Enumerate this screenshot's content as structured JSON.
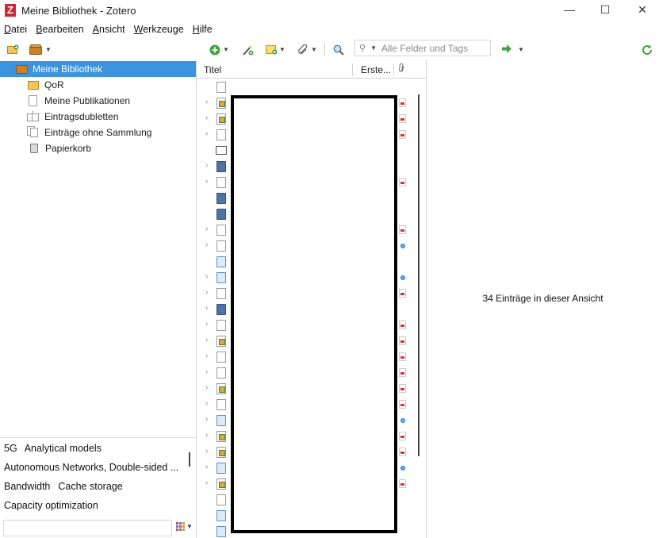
{
  "window": {
    "title": "Meine Bibliothek - Zotero",
    "logo_letter": "Z",
    "controls": {
      "minimize": "—",
      "maximize": "☐",
      "close": "✕"
    }
  },
  "menu": [
    {
      "label": "Datei"
    },
    {
      "label": "Bearbeiten"
    },
    {
      "label": "Ansicht"
    },
    {
      "label": "Werkzeuge"
    },
    {
      "label": "Hilfe"
    }
  ],
  "toolbar": {
    "search_placeholder": "Alle Felder und Tags",
    "colors": {
      "new_item": "#3fa63f",
      "locate": "#3fa63f",
      "sync": "#3fa63f"
    }
  },
  "collections": [
    {
      "label": "Meine Bibliothek",
      "icon": "library-icon",
      "selected": true
    },
    {
      "label": "QoR",
      "icon": "folder-icon"
    },
    {
      "label": "Meine Publikationen",
      "icon": "document-icon"
    },
    {
      "label": "Eintragsdubletten",
      "icon": "duplicates-icon"
    },
    {
      "label": "Einträge ohne Sammlung",
      "icon": "unfiled-icon"
    },
    {
      "label": "Papierkorb",
      "icon": "trash-icon"
    }
  ],
  "tags": {
    "rows": [
      [
        "5G",
        "Analytical models"
      ],
      [
        "Autonomous Networks, Double-sided ..."
      ],
      [
        "Bandwidth",
        "Cache storage"
      ],
      [
        "Capacity optimization"
      ]
    ],
    "filter_value": ""
  },
  "items_table": {
    "columns": {
      "title": "Titel",
      "creator": "Erste..."
    },
    "rows": [
      {
        "twisty": false,
        "type": "document",
        "attachment": ""
      },
      {
        "twisty": true,
        "type": "journal-article",
        "attachment": "pdf"
      },
      {
        "twisty": true,
        "type": "journal-article",
        "attachment": "pdf"
      },
      {
        "twisty": true,
        "type": "document",
        "attachment": "pdf"
      },
      {
        "twisty": false,
        "type": "presentation",
        "attachment": ""
      },
      {
        "twisty": true,
        "type": "book",
        "attachment": ""
      },
      {
        "twisty": true,
        "type": "document",
        "attachment": "pdf"
      },
      {
        "twisty": false,
        "type": "book",
        "attachment": ""
      },
      {
        "twisty": false,
        "type": "book",
        "attachment": ""
      },
      {
        "twisty": true,
        "type": "document",
        "attachment": "pdf"
      },
      {
        "twisty": true,
        "type": "document",
        "attachment": "link"
      },
      {
        "twisty": false,
        "type": "preprint",
        "attachment": ""
      },
      {
        "twisty": true,
        "type": "preprint",
        "attachment": "link"
      },
      {
        "twisty": true,
        "type": "document",
        "attachment": "pdf"
      },
      {
        "twisty": true,
        "type": "book",
        "attachment": ""
      },
      {
        "twisty": true,
        "type": "document",
        "attachment": "pdf"
      },
      {
        "twisty": true,
        "type": "journal-article",
        "attachment": "pdf"
      },
      {
        "twisty": true,
        "type": "document",
        "attachment": "pdf"
      },
      {
        "twisty": true,
        "type": "document",
        "attachment": "pdf"
      },
      {
        "twisty": true,
        "type": "journal-article",
        "attachment": "pdf"
      },
      {
        "twisty": true,
        "type": "document",
        "attachment": "pdf"
      },
      {
        "twisty": true,
        "type": "preprint",
        "attachment": "link"
      },
      {
        "twisty": true,
        "type": "journal-article",
        "attachment": "pdf"
      },
      {
        "twisty": true,
        "type": "journal-article",
        "attachment": "pdf"
      },
      {
        "twisty": true,
        "type": "preprint",
        "attachment": "link"
      },
      {
        "twisty": true,
        "type": "journal-article",
        "attachment": "pdf"
      },
      {
        "twisty": false,
        "type": "document",
        "attachment": ""
      },
      {
        "twisty": false,
        "type": "preprint",
        "attachment": ""
      },
      {
        "twisty": false,
        "type": "preprint",
        "attachment": ""
      }
    ]
  },
  "item_pane": {
    "message": "34 Einträge in dieser Ansicht"
  },
  "colors": {
    "selection": "#3c94dc",
    "accent": "#cc2936"
  }
}
